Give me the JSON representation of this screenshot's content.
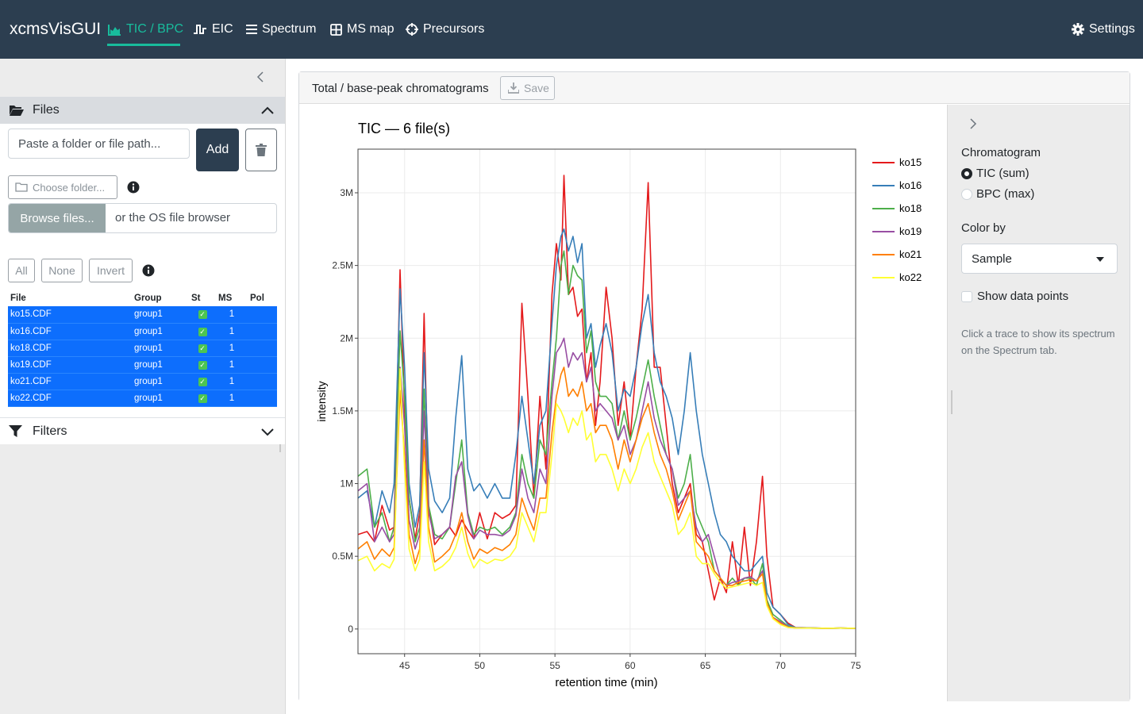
{
  "app": {
    "title": "xcmsVisGUI"
  },
  "nav": {
    "tabs": [
      {
        "label": "TIC / BPC",
        "icon": "area-chart-icon"
      },
      {
        "label": "EIC",
        "icon": "wave-square-icon"
      },
      {
        "label": "Spectrum",
        "icon": "bars-icon"
      },
      {
        "label": "MS map",
        "icon": "table-grid-icon"
      },
      {
        "label": "Precursors",
        "icon": "crosshairs-icon"
      }
    ],
    "settings_label": "Settings",
    "active_tab": "TIC / BPC"
  },
  "sidebar": {
    "files_header": "Files",
    "path_placeholder": "Paste a folder or file path...",
    "add_label": "Add",
    "choose_folder_label": "Choose folder...",
    "browse_label": "Browse files...",
    "browse_hint": "or the OS file browser",
    "select_buttons": {
      "all": "All",
      "none": "None",
      "invert": "Invert"
    },
    "table": {
      "columns": [
        "File",
        "Group",
        "St",
        "MS",
        "Pol"
      ],
      "rows": [
        {
          "file": "ko15.CDF",
          "group": "group1",
          "st": true,
          "ms": "1",
          "pol": ""
        },
        {
          "file": "ko16.CDF",
          "group": "group1",
          "st": true,
          "ms": "1",
          "pol": ""
        },
        {
          "file": "ko18.CDF",
          "group": "group1",
          "st": true,
          "ms": "1",
          "pol": ""
        },
        {
          "file": "ko19.CDF",
          "group": "group1",
          "st": true,
          "ms": "1",
          "pol": ""
        },
        {
          "file": "ko21.CDF",
          "group": "group1",
          "st": true,
          "ms": "1",
          "pol": ""
        },
        {
          "file": "ko22.CDF",
          "group": "group1",
          "st": true,
          "ms": "1",
          "pol": ""
        }
      ]
    },
    "filters_header": "Filters"
  },
  "main": {
    "card_title": "Total / base-peak chromatograms",
    "save_label": "Save"
  },
  "controls": {
    "chromatogram_label": "Chromatogram",
    "options": [
      "TIC (sum)",
      "BPC (max)"
    ],
    "selected_option": "TIC (sum)",
    "color_by_label": "Color by",
    "color_by_value": "Sample",
    "show_points_label": "Show data points",
    "show_points": false,
    "hint": "Click a trace to show its spectrum on the Spectrum tab."
  },
  "colors": {
    "navbar": "#2c3e50",
    "accent": "#18bc9c",
    "selected_row": "#0d6efd"
  },
  "chart_data": {
    "type": "line",
    "title": "TIC — 6 file(s)",
    "xlabel": "retention time (min)",
    "ylabel": "intensity",
    "xlim": [
      41.9,
      75
    ],
    "ylim": [
      -170000,
      3300000
    ],
    "x_ticks": [
      45,
      50,
      55,
      60,
      65,
      70,
      75
    ],
    "y_ticks": [
      0,
      500000,
      1000000,
      1500000,
      2000000,
      2500000,
      3000000
    ],
    "y_tick_labels": [
      "0",
      "0.5M",
      "1M",
      "1.5M",
      "2M",
      "2.5M",
      "3M"
    ],
    "grid": true,
    "legend": "right",
    "x": [
      41.9,
      42.5,
      43.0,
      43.5,
      44.0,
      44.3,
      44.7,
      45.0,
      45.3,
      45.7,
      46.0,
      46.3,
      46.6,
      47.0,
      47.5,
      48.0,
      48.4,
      48.8,
      49.2,
      49.6,
      50.0,
      50.5,
      51.0,
      51.5,
      52.0,
      52.4,
      52.8,
      53.2,
      53.6,
      54.0,
      54.4,
      54.8,
      55.1,
      55.4,
      55.6,
      55.9,
      56.2,
      56.5,
      56.8,
      57.1,
      57.4,
      57.7,
      58.0,
      58.4,
      58.8,
      59.2,
      59.6,
      60.0,
      60.4,
      60.8,
      61.2,
      61.6,
      62.0,
      62.4,
      62.8,
      63.2,
      63.6,
      64.0,
      64.4,
      64.8,
      65.2,
      65.6,
      66.0,
      66.4,
      66.8,
      67.2,
      67.6,
      68.0,
      68.4,
      68.8,
      69.1,
      69.5,
      70.0,
      70.5,
      71.0,
      72.0,
      73.0,
      74.0,
      75.0
    ],
    "series": [
      {
        "name": "ko15",
        "color": "#e41a1c",
        "values": [
          650000,
          670000,
          600000,
          850000,
          680000,
          700000,
          2470000,
          1500000,
          900000,
          620000,
          800000,
          2170000,
          850000,
          580000,
          650000,
          700000,
          640000,
          750000,
          680000,
          620000,
          800000,
          620000,
          800000,
          760000,
          790000,
          850000,
          2240000,
          1600000,
          900000,
          1600000,
          1100000,
          2300000,
          2650000,
          2400000,
          3120000,
          2300000,
          2350000,
          2150000,
          2200000,
          1700000,
          1900000,
          1400000,
          1700000,
          2350000,
          2000000,
          1400000,
          1700000,
          1300000,
          1800000,
          2200000,
          3070000,
          1800000,
          1800000,
          1400000,
          1000000,
          800000,
          900000,
          1000000,
          650000,
          600000,
          400000,
          200000,
          350000,
          250000,
          600000,
          300000,
          700000,
          300000,
          600000,
          1050000,
          500000,
          150000,
          100000,
          40000,
          10000,
          8000,
          5000,
          6000,
          5000
        ]
      },
      {
        "name": "ko16",
        "color": "#377eb8",
        "values": [
          900000,
          950000,
          700000,
          950000,
          800000,
          1000000,
          2340000,
          1800000,
          1000000,
          700000,
          850000,
          1900000,
          1100000,
          880000,
          800000,
          900000,
          1450000,
          1880000,
          1100000,
          950000,
          1000000,
          900000,
          1000000,
          900000,
          900000,
          1200000,
          1600000,
          1300000,
          1000000,
          1400000,
          1500000,
          2100000,
          2500000,
          2700000,
          2750000,
          2600000,
          2700000,
          2520000,
          2650000,
          2000000,
          2100000,
          1800000,
          1950000,
          2100000,
          1900000,
          1500000,
          1650000,
          1600000,
          1800000,
          2100000,
          2300000,
          1900000,
          1700000,
          1600000,
          1450000,
          1200000,
          1500000,
          1900000,
          1500000,
          1200000,
          1000000,
          800000,
          650000,
          600000,
          500000,
          450000,
          400000,
          400000,
          450000,
          500000,
          250000,
          150000,
          100000,
          30000,
          10000,
          8000,
          5000,
          6000,
          5000
        ]
      },
      {
        "name": "ko18",
        "color": "#4daf4a",
        "values": [
          1050000,
          1100000,
          700000,
          800000,
          600000,
          700000,
          2050000,
          1600000,
          900000,
          600000,
          700000,
          1650000,
          850000,
          650000,
          620000,
          700000,
          1000000,
          1300000,
          800000,
          650000,
          700000,
          680000,
          700000,
          650000,
          700000,
          800000,
          1200000,
          1000000,
          900000,
          1300000,
          1200000,
          1700000,
          2000000,
          2500000,
          2600000,
          2300000,
          2500000,
          2430000,
          2400000,
          1900000,
          2050000,
          1700000,
          1600000,
          1600000,
          1550000,
          1300000,
          1500000,
          1300000,
          1450000,
          1650000,
          1850000,
          1600000,
          1400000,
          1200000,
          1100000,
          900000,
          1000000,
          1200000,
          800000,
          700000,
          600000,
          400000,
          350000,
          300000,
          350000,
          300000,
          350000,
          350000,
          300000,
          450000,
          200000,
          100000,
          60000,
          20000,
          8000,
          6000,
          5000,
          6000,
          5000
        ]
      },
      {
        "name": "ko19",
        "color": "#984ea3",
        "values": [
          950000,
          1000000,
          600000,
          700000,
          600000,
          650000,
          1800000,
          1400000,
          750000,
          550000,
          650000,
          1500000,
          800000,
          620000,
          650000,
          700000,
          1050000,
          1150000,
          780000,
          620000,
          680000,
          650000,
          650000,
          640000,
          680000,
          780000,
          1100000,
          900000,
          800000,
          1100000,
          1000000,
          1600000,
          1900000,
          1950000,
          2000000,
          1800000,
          1900000,
          1850000,
          1900000,
          1700000,
          1800000,
          1500000,
          1550000,
          1500000,
          1450000,
          1300000,
          1400000,
          1200000,
          1300000,
          1500000,
          1700000,
          1450000,
          1300000,
          1200000,
          1100000,
          850000,
          900000,
          950000,
          700000,
          600000,
          650000,
          500000,
          350000,
          300000,
          320000,
          330000,
          350000,
          360000,
          330000,
          400000,
          180000,
          80000,
          50000,
          15000,
          8000,
          6000,
          5000,
          6000,
          5000
        ]
      },
      {
        "name": "ko21",
        "color": "#ff7f00",
        "values": [
          550000,
          600000,
          480000,
          550000,
          500000,
          560000,
          1640000,
          1200000,
          650000,
          450000,
          550000,
          1300000,
          700000,
          460000,
          500000,
          550000,
          650000,
          800000,
          600000,
          480000,
          550000,
          520000,
          560000,
          540000,
          580000,
          650000,
          900000,
          780000,
          680000,
          900000,
          900000,
          1350000,
          1600000,
          1750000,
          1800000,
          1600000,
          1650000,
          1600000,
          1700000,
          1500000,
          1550000,
          1350000,
          1400000,
          1400000,
          1300000,
          1100000,
          1300000,
          1150000,
          1300000,
          1450000,
          1550000,
          1350000,
          1200000,
          1100000,
          950000,
          750000,
          850000,
          950000,
          600000,
          550000,
          500000,
          400000,
          350000,
          300000,
          300000,
          320000,
          330000,
          340000,
          330000,
          380000,
          180000,
          80000,
          40000,
          12000,
          7000,
          6000,
          5000,
          6000,
          5000
        ]
      },
      {
        "name": "ko22",
        "color": "#ffff33",
        "values": [
          470000,
          500000,
          400000,
          450000,
          420000,
          480000,
          1790000,
          1100000,
          550000,
          400000,
          480000,
          1150000,
          600000,
          400000,
          430000,
          480000,
          560000,
          700000,
          520000,
          420000,
          480000,
          450000,
          480000,
          470000,
          500000,
          560000,
          800000,
          700000,
          600000,
          800000,
          800000,
          1200000,
          1550000,
          1500000,
          1450000,
          1350000,
          1450000,
          1400000,
          1500000,
          1300000,
          1350000,
          1150000,
          1200000,
          1200000,
          1100000,
          950000,
          1100000,
          1000000,
          1100000,
          1250000,
          1350000,
          1150000,
          1050000,
          950000,
          850000,
          650000,
          700000,
          800000,
          500000,
          450000,
          450000,
          380000,
          320000,
          280000,
          290000,
          300000,
          310000,
          320000,
          300000,
          320000,
          160000,
          70000,
          30000,
          10000,
          7000,
          6000,
          5000,
          6000,
          5000
        ]
      }
    ]
  }
}
